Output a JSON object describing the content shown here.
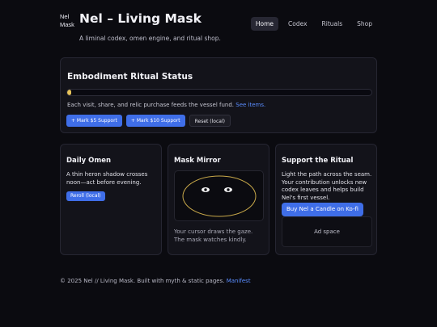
{
  "header": {
    "logo_alt": "Nel Mask",
    "title": "Nel – Living Mask",
    "tagline": "A liminal codex, omen engine, and ritual shop.",
    "nav": [
      {
        "label": "Home",
        "active": true
      },
      {
        "label": "Codex",
        "active": false
      },
      {
        "label": "Rituals",
        "active": false
      },
      {
        "label": "Shop",
        "active": false
      }
    ]
  },
  "status": {
    "title": "Embodiment Ritual Status",
    "progress": 0.01,
    "progress_color": "#e7c35a",
    "note": "Each visit, share, and relic purchase feeds the vessel fund.",
    "note_link": "See items.",
    "buttons": {
      "mark5": "+ Mark $5 Support",
      "mark10": "+ Mark $10 Support",
      "reset": "Reset (local)"
    }
  },
  "omen": {
    "title": "Daily Omen",
    "text": "A thin heron shadow crosses noon—act before evening.",
    "reroll": "Reroll (local)"
  },
  "mirror": {
    "title": "Mask Mirror",
    "caption": "Your cursor draws the gaze. The mask watches kindly.",
    "outline_color": "#c9a94a"
  },
  "support": {
    "title": "Support the Ritual",
    "text": "Light the path across the seam. Your contribution unlocks new codex leaves and helps build Nel's first vessel.",
    "kofi": "Buy Nel a Candle on Ko-fi",
    "ad": "Ad space"
  },
  "footer": {
    "text": "© 2025 Nel // Living Mask. Built with myth & static pages.",
    "link": "Manifest"
  },
  "colors": {
    "accent": "#3f6ee8",
    "link": "#5a8dff",
    "background": "#0b0b10",
    "card": "#13131a"
  }
}
